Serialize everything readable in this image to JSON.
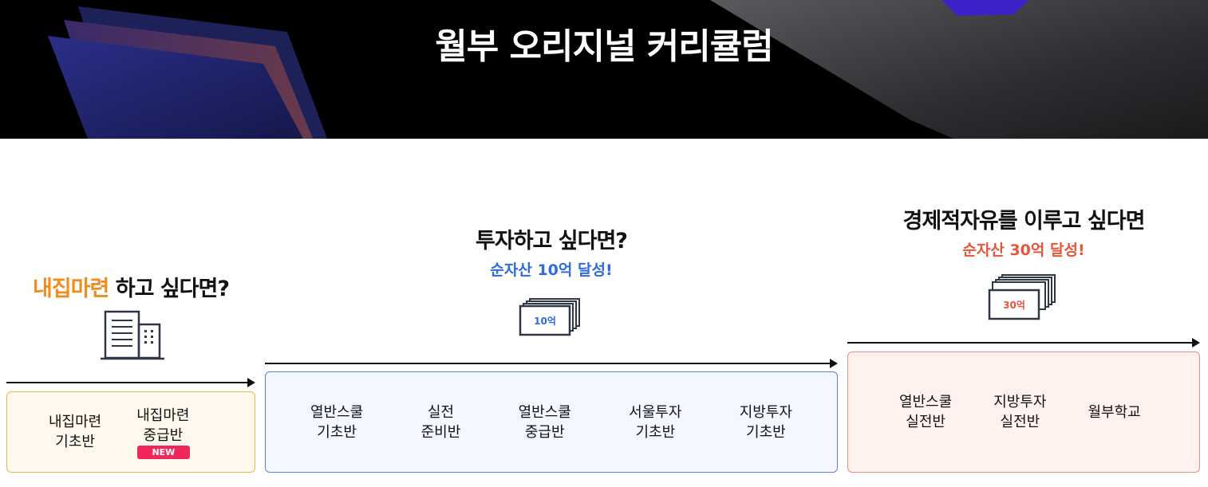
{
  "hero": {
    "title": "월부 오리지널 커리큘럼"
  },
  "col1": {
    "highlight": "내집마련",
    "heading_rest": " 하고 싶다면?",
    "courses": [
      {
        "line1": "내집마련",
        "line2": "기초반",
        "badge": ""
      },
      {
        "line1": "내집마련",
        "line2": "중급반",
        "badge": "NEW"
      }
    ]
  },
  "col2": {
    "heading": "투자하고 싶다면?",
    "sub": "순자산 10억 달성!",
    "icon_label": "10억",
    "courses": [
      {
        "line1": "열반스쿨",
        "line2": "기초반"
      },
      {
        "line1": "실전",
        "line2": "준비반"
      },
      {
        "line1": "열반스쿨",
        "line2": "중급반"
      },
      {
        "line1": "서울투자",
        "line2": "기초반"
      },
      {
        "line1": "지방투자",
        "line2": "기초반"
      }
    ]
  },
  "col3": {
    "heading": "경제적자유를 이루고 싶다면",
    "sub": "순자산 30억 달성!",
    "icon_label": "30억",
    "courses": [
      {
        "line1": "열반스쿨",
        "line2": "실전반"
      },
      {
        "line1": "지방투자",
        "line2": "실전반"
      },
      {
        "line1": "월부학교",
        "line2": ""
      }
    ]
  },
  "colors": {
    "orange": "#f08c1e",
    "blue": "#2f6ae0",
    "red": "#e8553a",
    "box1_bg": "#fff8ec",
    "box1_border": "#e8b64a",
    "box2_bg": "#f4f7ff",
    "box2_border": "#5a7fe0",
    "box3_bg": "#fff1ee",
    "box3_border": "#ec8f80"
  }
}
